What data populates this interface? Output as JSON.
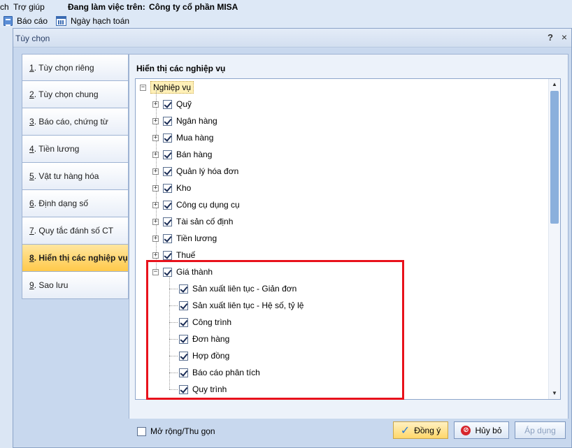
{
  "app": {
    "menu": {
      "item1": "ch",
      "item2": "Trợ giúp"
    },
    "working_on_label": "Đang làm việc trên:",
    "company": "Công ty cổ phần MISA",
    "toolbar": {
      "report": "Báo cáo",
      "posting_date": "Ngày hạch toán"
    }
  },
  "dialog": {
    "title": "Tùy chọn",
    "help": "?",
    "close": "×",
    "nav": [
      {
        "num": "1",
        "label": ". Tùy chọn riêng"
      },
      {
        "num": "2",
        "label": ". Tùy chọn chung"
      },
      {
        "num": "3",
        "label": ". Báo cáo, chứng từ"
      },
      {
        "num": "4",
        "label": ". Tiền lương"
      },
      {
        "num": "5",
        "label": ". Vật tư hàng hóa"
      },
      {
        "num": "6",
        "label": ". Định dạng số"
      },
      {
        "num": "7",
        "label": ". Quy tắc đánh số CT"
      },
      {
        "num": "8",
        "label": ". Hiển thị các nghiệp vụ",
        "active": true
      },
      {
        "num": "9",
        "label": ". Sao lưu"
      }
    ],
    "panel_title": "Hiển thị các nghiệp vụ",
    "tree": {
      "root": "Nghiệp vụ",
      "root_expander": "−",
      "items": [
        {
          "label": "Quỹ",
          "expander": "+",
          "checked": true
        },
        {
          "label": "Ngân hàng",
          "expander": "+",
          "checked": true
        },
        {
          "label": "Mua hàng",
          "expander": "+",
          "checked": true
        },
        {
          "label": "Bán hàng",
          "expander": "+",
          "checked": true
        },
        {
          "label": "Quản lý hóa đơn",
          "expander": "+",
          "checked": true
        },
        {
          "label": "Kho",
          "expander": "+",
          "checked": true
        },
        {
          "label": "Công cụ dụng cụ",
          "expander": "+",
          "checked": true
        },
        {
          "label": "Tài sản cố định",
          "expander": "+",
          "checked": true
        },
        {
          "label": "Tiền lương",
          "expander": "+",
          "checked": true
        },
        {
          "label": "Thuế",
          "expander": "+",
          "checked": true
        },
        {
          "label": "Giá thành",
          "expander": "−",
          "checked": true
        }
      ],
      "children": [
        {
          "label": "Sản xuất liên tục - Giản đơn",
          "checked": true
        },
        {
          "label": "Sản xuất liên tục - Hệ số, tỷ lệ",
          "checked": true
        },
        {
          "label": "Công trình",
          "checked": true
        },
        {
          "label": "Đơn hàng",
          "checked": true
        },
        {
          "label": "Hợp đồng",
          "checked": true
        },
        {
          "label": "Báo cáo phân tích",
          "checked": true
        },
        {
          "label": "Quy trình",
          "checked": true
        }
      ],
      "scroll_up": "▲",
      "scroll_down": "▼"
    },
    "footer": {
      "expand_collapse": "Mở rộng/Thu gọn",
      "ok": "Đồng ý",
      "cancel": "Hủy bỏ",
      "apply": "Áp dụng"
    }
  },
  "colors": {
    "highlight": "#e8121c",
    "active_tab": "#ffc94a"
  }
}
